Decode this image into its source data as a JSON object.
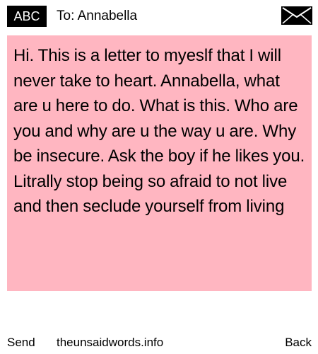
{
  "header": {
    "mode_badge": "ABC",
    "recipient": "To: Annabella",
    "icon": "envelope-icon"
  },
  "letter": {
    "body": "Hi. This is a letter to myeslf that I will never take to heart. Annabella, what are u here to do. What is this. Who are you and why are u the way u are. Why be insecure. Ask the boy if he likes you. Litrally stop being so afraid to not live and then seclude yourself from living",
    "background_color": "#ffb6c1"
  },
  "footer": {
    "send_label": "Send",
    "site_label": "theunsaidwords.info",
    "back_label": "Back"
  }
}
